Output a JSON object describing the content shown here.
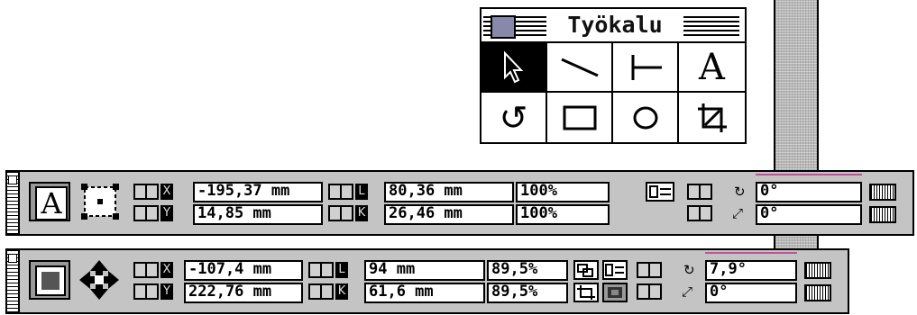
{
  "tool_palette": {
    "title": "Työkalu",
    "tools": [
      {
        "name": "pointer-tool",
        "icon": "arrow-pointer-icon",
        "selected": true
      },
      {
        "name": "line-tool",
        "icon": "diagonal-line-icon",
        "selected": false
      },
      {
        "name": "orthogonal-line-tool",
        "icon": "orthogonal-line-icon",
        "selected": false
      },
      {
        "name": "text-tool",
        "icon": "letter-a-icon",
        "glyph": "A",
        "selected": false
      },
      {
        "name": "rotate-tool",
        "icon": "rotate-icon",
        "glyph": "↺",
        "selected": false
      },
      {
        "name": "rectangle-tool",
        "icon": "rectangle-icon",
        "selected": false
      },
      {
        "name": "oval-tool",
        "icon": "oval-icon",
        "selected": false
      },
      {
        "name": "crop-tool",
        "icon": "crop-icon",
        "selected": false
      }
    ]
  },
  "palette1": {
    "x_label": "X",
    "x_value": "-195,37 mm",
    "y_label": "Y",
    "y_value": "14,85 mm",
    "w_label": "L",
    "w_value": "80,36 mm",
    "h_label": "K",
    "h_value": "26,46 mm",
    "scale_x": "100%",
    "scale_y": "100%",
    "angle": "0°",
    "skew": "0°"
  },
  "palette2": {
    "x_label": "X",
    "x_value": "-107,4 mm",
    "y_label": "Y",
    "y_value": "222,76 mm",
    "w_label": "L",
    "w_value": "94 mm",
    "h_label": "K",
    "h_value": "61,6 mm",
    "scale_x": "89,5%",
    "scale_y": "89,5%",
    "angle": "7,9°",
    "skew": "0°"
  },
  "colors": {
    "palette_bg": "#c4c4c4",
    "accent_line": "#c0509a"
  }
}
